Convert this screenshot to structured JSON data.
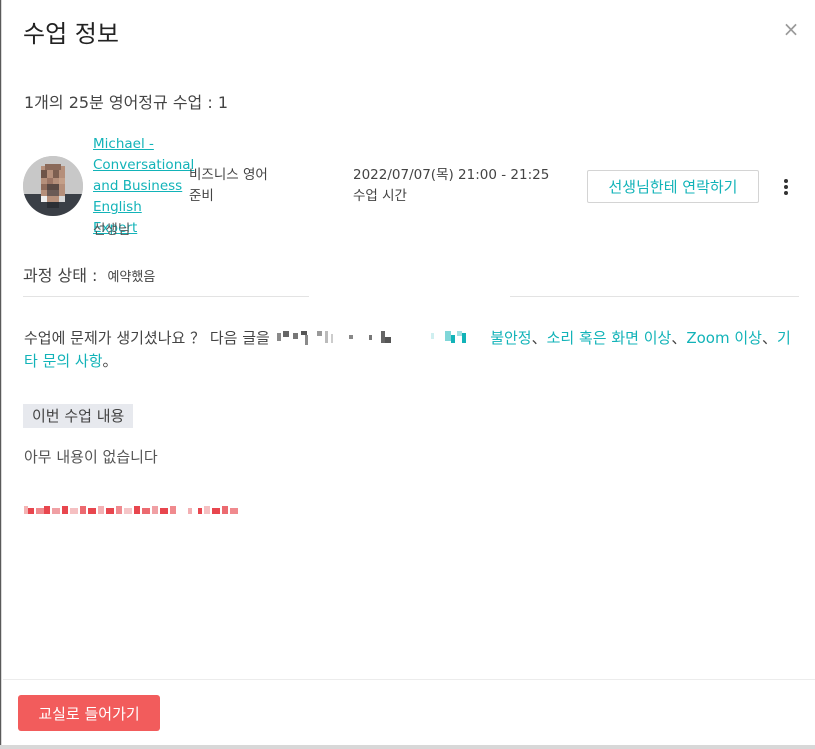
{
  "modal": {
    "title": "수업 정보",
    "close_label": "×"
  },
  "summary": "1개의 25분 영어정규 수업 : 1",
  "teacher": {
    "name_lines": [
      "Michael -",
      "Conversational",
      "and Business",
      "English Expert"
    ],
    "role": "선생님"
  },
  "course": {
    "lines": [
      "비즈니스 영어",
      "준비"
    ]
  },
  "schedule": {
    "datetime": "2022/07/07(목) 21:00 - 21:25",
    "label": "수업 시간"
  },
  "contact_button": "선생님한테 연락하기",
  "status": {
    "label": "과정 상태 :",
    "value": "예약했음"
  },
  "problem": {
    "lead": "수업에 문제가 생기셨나요 ？ 다음 글을",
    "links": [
      "불안정",
      "소리 혹은 화면 이상",
      "Zoom 이상",
      "기타 문의 사항"
    ],
    "separator": "、",
    "end": "。"
  },
  "lesson_content": {
    "label": "이번 수업 내용",
    "empty_text": "아무 내용이 없습니다"
  },
  "enter_button": "교실로 들어가기",
  "colors": {
    "accent": "#12b3b8",
    "primary_button": "#f25c5c",
    "tag_bg": "#e7e9ee"
  }
}
